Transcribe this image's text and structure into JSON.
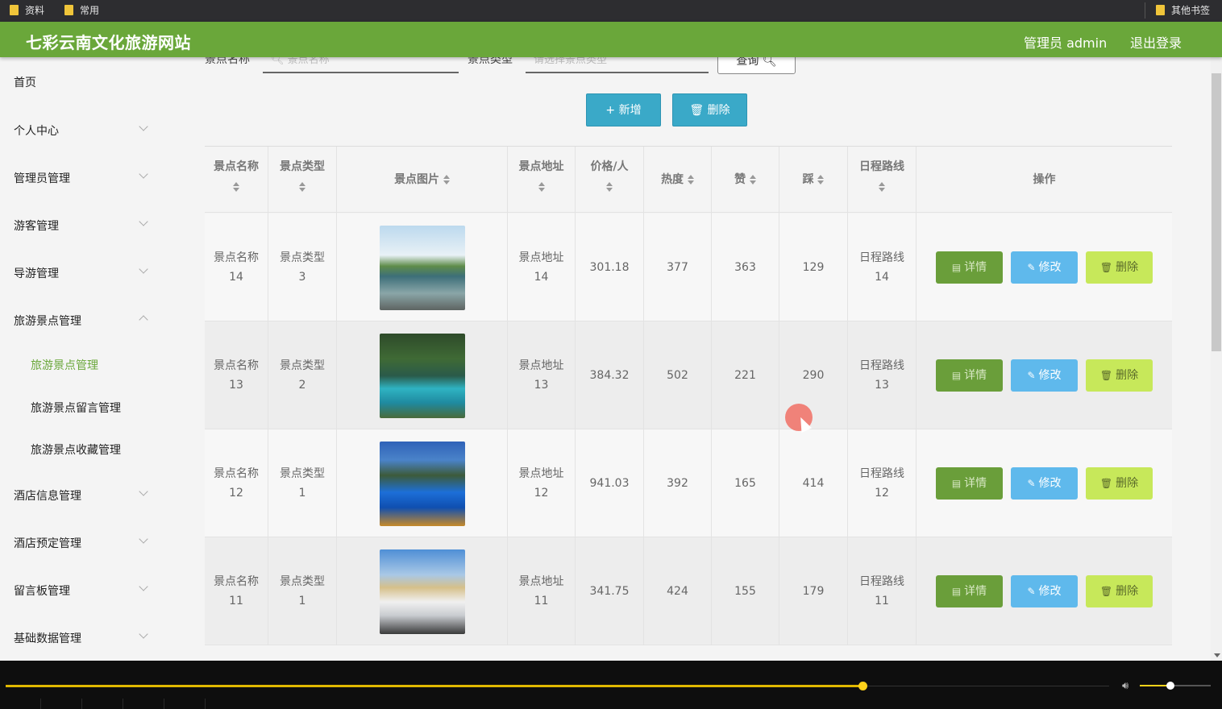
{
  "bookmarks": {
    "left": [
      {
        "label": "资料"
      },
      {
        "label": "常用"
      }
    ],
    "right": {
      "label": "其他书签"
    }
  },
  "header": {
    "title": "七彩云南文化旅游网站",
    "admin": "管理员 admin",
    "logout": "退出登录"
  },
  "sidebar": {
    "items": [
      {
        "label": "首页"
      },
      {
        "label": "个人中心"
      },
      {
        "label": "管理员管理"
      },
      {
        "label": "游客管理"
      },
      {
        "label": "导游管理"
      },
      {
        "label": "旅游景点管理"
      },
      {
        "label": "酒店信息管理"
      },
      {
        "label": "酒店预定管理"
      },
      {
        "label": "留言板管理"
      },
      {
        "label": "基础数据管理"
      }
    ],
    "subitems": [
      {
        "label": "旅游景点管理",
        "active": true
      },
      {
        "label": "旅游景点留言管理"
      },
      {
        "label": "旅游景点收藏管理"
      }
    ]
  },
  "search": {
    "name_label": "景点名称",
    "name_placeholder": "景点名称",
    "type_label": "景点类型",
    "type_placeholder": "请选择景点类型",
    "query_button": "查询"
  },
  "toolbar": {
    "add_label": "新增",
    "delete_label": "删除"
  },
  "table": {
    "headers": [
      "景点名称",
      "景点类型",
      "景点图片",
      "景点地址",
      "价格/人",
      "热度",
      "赞",
      "踩",
      "日程路线",
      "操作"
    ],
    "rows": [
      {
        "name": "景点名称",
        "name_no": "14",
        "type": "景点类型",
        "type_no": "3",
        "addr": "景点地址",
        "addr_no": "14",
        "price": "301.18",
        "heat": "377",
        "like": "363",
        "dislike": "129",
        "route": "日程路线",
        "route_no": "14"
      },
      {
        "name": "景点名称",
        "name_no": "13",
        "type": "景点类型",
        "type_no": "2",
        "addr": "景点地址",
        "addr_no": "13",
        "price": "384.32",
        "heat": "502",
        "like": "221",
        "dislike": "290",
        "route": "日程路线",
        "route_no": "13"
      },
      {
        "name": "景点名称",
        "name_no": "12",
        "type": "景点类型",
        "type_no": "1",
        "addr": "景点地址",
        "addr_no": "12",
        "price": "941.03",
        "heat": "392",
        "like": "165",
        "dislike": "414",
        "route": "日程路线",
        "route_no": "12"
      },
      {
        "name": "景点名称",
        "name_no": "11",
        "type": "景点类型",
        "type_no": "1",
        "addr": "景点地址",
        "addr_no": "11",
        "price": "341.75",
        "heat": "424",
        "like": "155",
        "dislike": "179",
        "route": "日程路线",
        "route_no": "11"
      }
    ],
    "actions": {
      "detail": "详情",
      "edit": "修改",
      "delete": "删除"
    }
  },
  "player": {
    "progress": 0.7,
    "volume": 0.43
  },
  "colors": {
    "header": "#6aa73a",
    "active": "#6aa73a",
    "add_button": "#3aa9c8",
    "detail_button": "#6a9e3a",
    "edit_button": "#5fb9ec",
    "delete_button": "#c7e85a"
  }
}
